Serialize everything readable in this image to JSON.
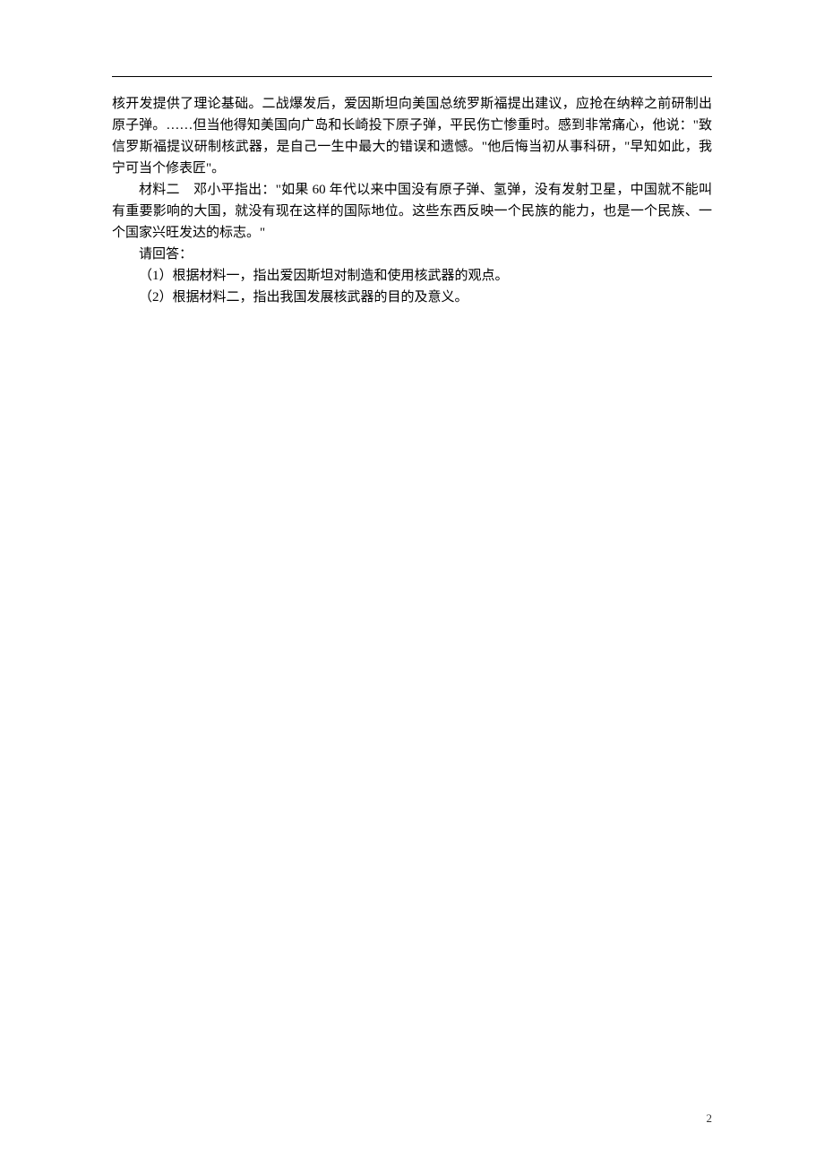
{
  "rule": "",
  "paragraphs": {
    "p1": "核开发提供了理论基础。二战爆发后，爱因斯坦向美国总统罗斯福提出建议，应抢在纳粹之前研制出原子弹。……但当他得知美国向广岛和长崎投下原子弹，平民伤亡惨重时。感到非常痛心，他说：\"致信罗斯福提议研制核武器，是自己一生中最大的错误和遗憾。\"他后悔当初从事科研，\"早知如此，我宁可当个修表匠\"。",
    "p2": "材料二　邓小平指出：\"如果 60 年代以来中国没有原子弹、氢弹，没有发射卫星，中国就不能叫有重要影响的大国，就没有现在这样的国际地位。这些东西反映一个民族的能力，也是一个民族、一个国家兴旺发达的标志。\"",
    "p3": "请回答：",
    "p4": "（1）根据材料一，指出爱因斯坦对制造和使用核武器的观点。",
    "p5": "（2）根据材料二，指出我国发展核武器的目的及意义。"
  },
  "page_number": "2"
}
